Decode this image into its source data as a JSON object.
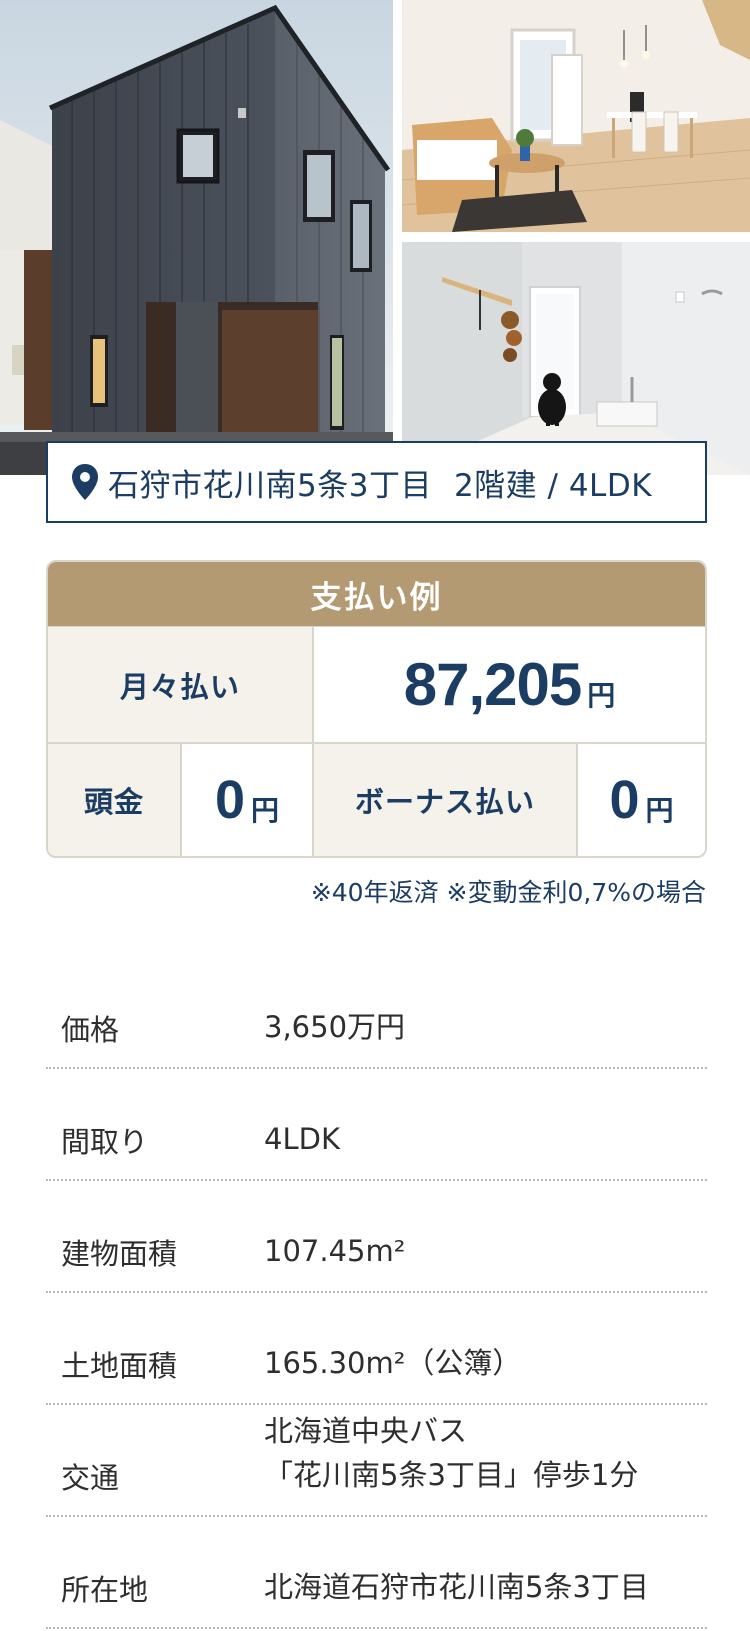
{
  "photos": {
    "exterior_alt": "",
    "living_alt": "",
    "entry_alt": ""
  },
  "location": {
    "icon": "map-pin-icon",
    "address": "石狩市花川南5条3丁目",
    "summary": "2階建 / 4LDK"
  },
  "payment": {
    "title": "支払い例",
    "monthly_label": "月々払い",
    "monthly_value": "87,205",
    "monthly_unit": "円",
    "down_label": "頭金",
    "down_value": "0",
    "down_unit": "円",
    "bonus_label": "ボーナス払い",
    "bonus_value": "0",
    "bonus_unit": "円",
    "note": "※40年返済 ※変動金利0,7%の場合"
  },
  "specs": [
    {
      "label": "価格",
      "value": "3,650万円"
    },
    {
      "label": "間取り",
      "value": "4LDK"
    },
    {
      "label": "建物面積",
      "value": "107.45m²"
    },
    {
      "label": "土地面積",
      "value": "165.30m²（公簿）"
    },
    {
      "label": "交通",
      "value_line1": "北海道中央バス",
      "value_line2": "「花川南5条3丁目」停歩1分"
    },
    {
      "label": "所在地",
      "value": "北海道石狩市花川南5条3丁目"
    }
  ],
  "colors": {
    "navy": "#1c3d63",
    "gold": "#b39a72",
    "beige": "#f5f2ec"
  }
}
